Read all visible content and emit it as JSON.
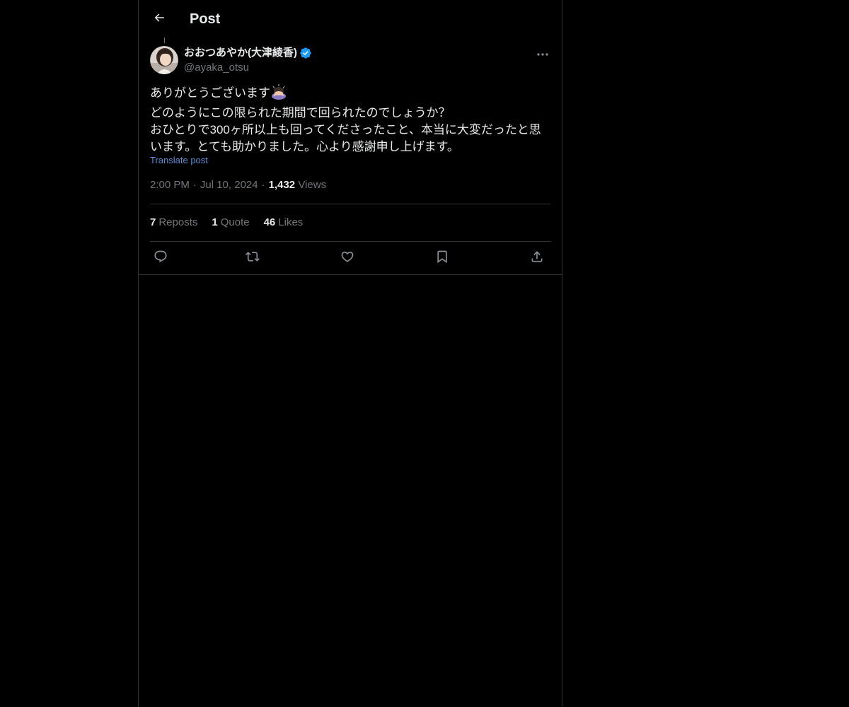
{
  "header": {
    "back_icon": "arrow-left-icon",
    "title": "Post"
  },
  "author": {
    "display_name": "おおつあやか(大津綾香)",
    "verified_icon": "verified-badge-icon",
    "handle": "@ayaka_otsu",
    "more_icon": "more-horizontal-icon"
  },
  "post": {
    "lines": [
      "ありがとうございます",
      "どのようにこの限られた期間で回られたのでしょうか？",
      "おひとりで300ヶ所以上も回ってくださったこと、本当に大変だったと思",
      "います。とても助かりました。心より感謝申し上げます。"
    ],
    "emoji_icon": "bowing-person-emoji-icon",
    "translate_label": "Translate post"
  },
  "meta": {
    "time": "2:00 PM",
    "separator": "·",
    "date": "Jul 10, 2024",
    "views_count": "1,432",
    "views_label": "Views"
  },
  "stats": {
    "reposts_count": "7",
    "reposts_label": "Reposts",
    "quotes_count": "1",
    "quotes_label": "Quote",
    "likes_count": "46",
    "likes_label": "Likes"
  },
  "actions": {
    "reply_icon": "reply-icon",
    "repost_icon": "repost-icon",
    "like_icon": "heart-icon",
    "bookmark_icon": "bookmark-icon",
    "share_icon": "share-icon"
  },
  "colors": {
    "background": "#000000",
    "text_primary": "#e7e9ea",
    "text_secondary": "#71767b",
    "border": "#2f3336",
    "link": "#5b8fd9",
    "verified": "#1d9bf0"
  }
}
